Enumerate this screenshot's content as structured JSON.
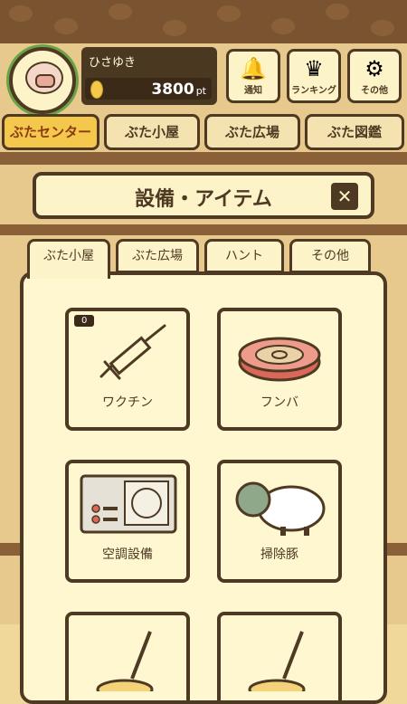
{
  "header": {
    "username": "ひさゆき",
    "points_value": "3800",
    "points_unit": "pt",
    "buttons": [
      {
        "label": "通知",
        "icon": "bell-icon"
      },
      {
        "label": "ランキング",
        "icon": "crown-icon"
      },
      {
        "label": "その他",
        "icon": "gear-icon"
      }
    ]
  },
  "categories": [
    {
      "label": "ぶたセンター",
      "active": true
    },
    {
      "label": "ぶた小屋",
      "active": false
    },
    {
      "label": "ぶた広場",
      "active": false
    },
    {
      "label": "ぶた図鑑",
      "active": false
    }
  ],
  "modal": {
    "title": "設備・アイテム",
    "close_icon": "close-icon",
    "tabs": [
      {
        "label": "ぶた小屋",
        "active": true
      },
      {
        "label": "ぶた広場",
        "active": false
      },
      {
        "label": "ハント",
        "active": false
      },
      {
        "label": "その他",
        "active": false
      }
    ],
    "items": [
      {
        "label": "ワクチン",
        "count": "0",
        "icon": "syringe-icon"
      },
      {
        "label": "フンバ",
        "icon": "dung-tray-icon"
      },
      {
        "label": "空調設備",
        "icon": "air-conditioner-icon"
      },
      {
        "label": "掃除豚",
        "icon": "cleaning-pig-icon"
      },
      {
        "label": "",
        "icon": "shovel-icon"
      },
      {
        "label": "",
        "icon": "shovel-icon"
      }
    ]
  },
  "colors": {
    "brown": "#4e3a22",
    "cream": "#fdf3c8",
    "gold": "#f4c84c",
    "green": "#6aa447"
  }
}
